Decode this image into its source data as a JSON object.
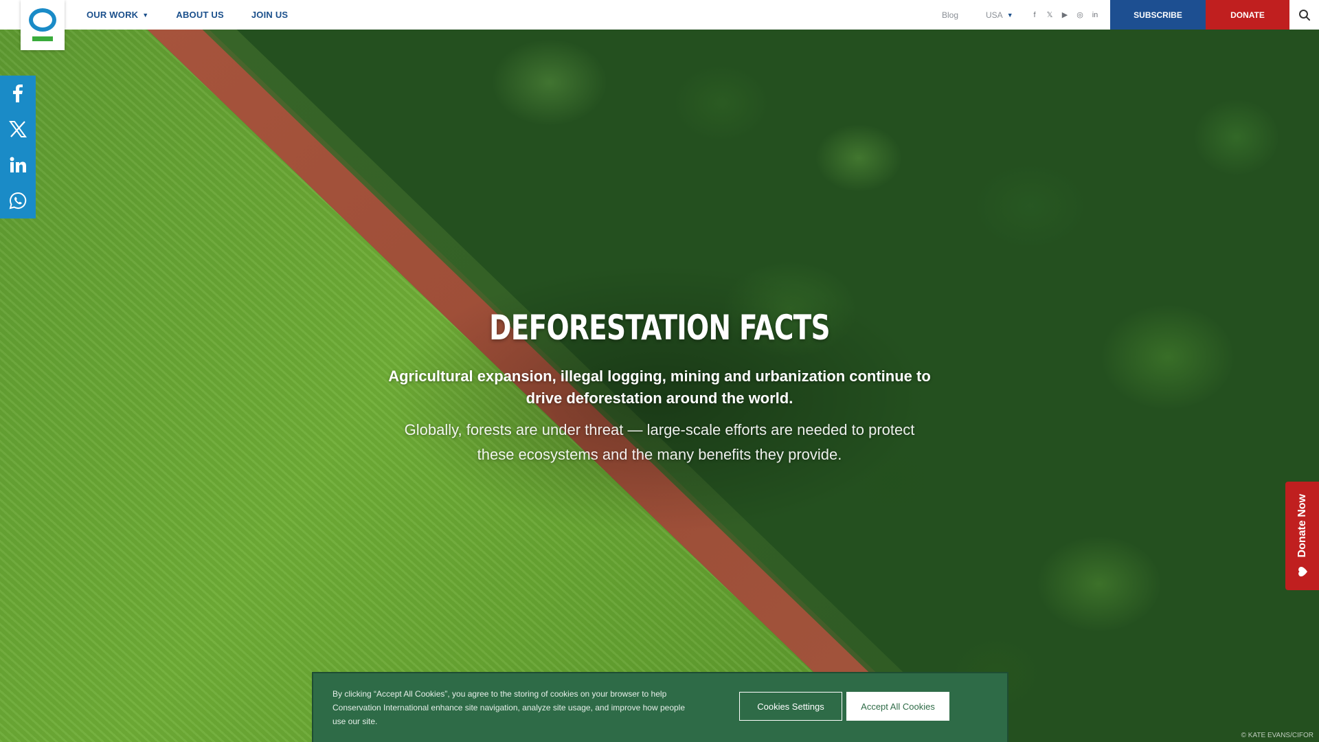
{
  "header": {
    "nav": [
      {
        "label": "OUR WORK",
        "has_dropdown": true
      },
      {
        "label": "ABOUT US",
        "has_dropdown": false
      },
      {
        "label": "JOIN US",
        "has_dropdown": false
      }
    ],
    "blog_label": "Blog",
    "region_label": "USA",
    "socials": [
      "facebook-icon",
      "x-icon",
      "youtube-icon",
      "instagram-icon",
      "linkedin-icon"
    ],
    "subscribe_label": "SUBSCRIBE",
    "donate_label": "DONATE",
    "colors": {
      "subscribe": "#1d4f91",
      "donate": "#c01f1f",
      "nav_text": "#1a4f8b"
    }
  },
  "share": [
    "facebook-icon",
    "x-icon",
    "linkedin-icon",
    "whatsapp-icon"
  ],
  "hero": {
    "title": "DEFORESTATION FACTS",
    "lead": "Agricultural expansion, illegal logging, mining and urbanization continue to drive deforestation around the world.",
    "body": "Globally, forests are under threat — large-scale efforts are needed to protect these ecosystems and the many benefits they provide.",
    "credit": "© KATE EVANS/CIFOR"
  },
  "donate_tab": {
    "label": "Donate Now"
  },
  "cookie": {
    "text": "By clicking “Accept All Cookies”, you agree to the storing of cookies on your browser to help Conservation International enhance site navigation, analyze site usage, and improve how people use our site.",
    "settings_label": "Cookies Settings",
    "accept_label": "Accept All Cookies"
  }
}
